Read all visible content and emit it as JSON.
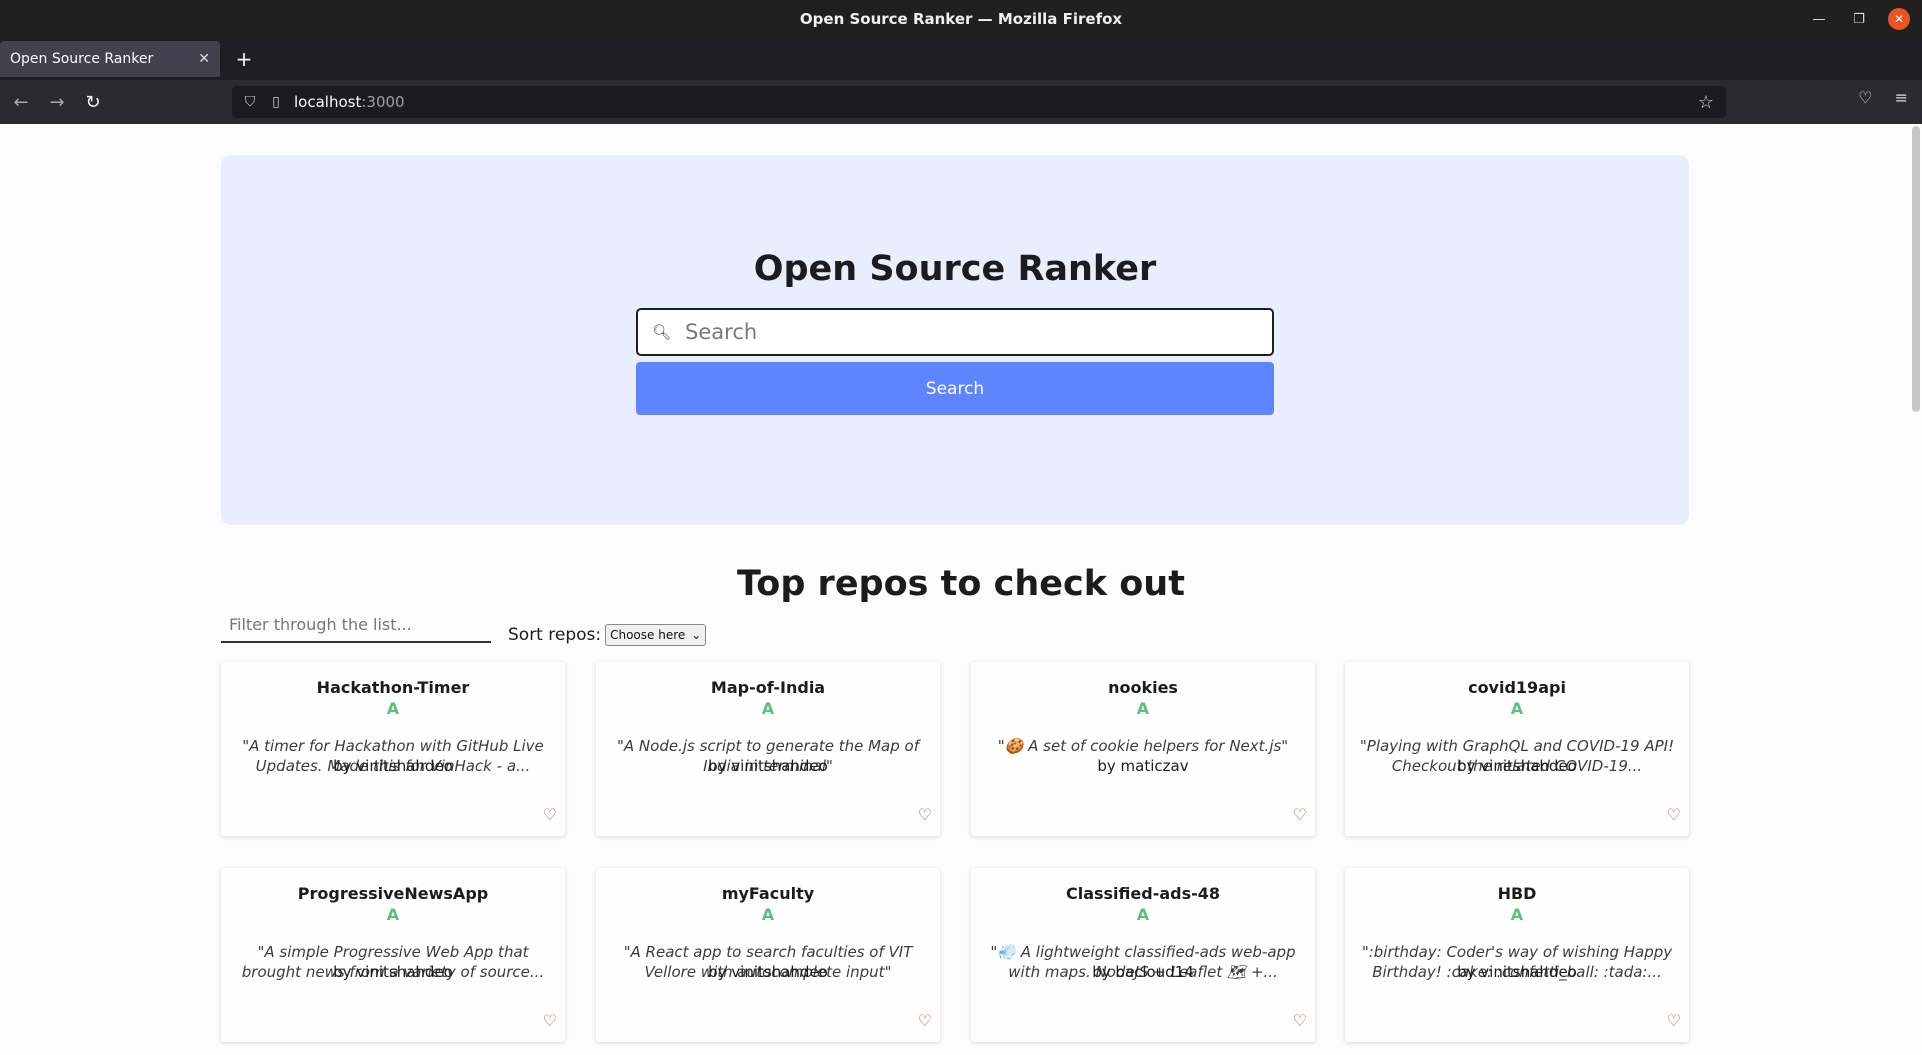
{
  "window": {
    "title": "Open Source Ranker — Mozilla Firefox"
  },
  "browser": {
    "tab_title": "Open Source Ranker",
    "url_host": "localhost",
    "url_port": ":3000"
  },
  "hero": {
    "title": "Open Source Ranker",
    "search_placeholder": "Search",
    "search_button": "Search"
  },
  "list": {
    "title": "Top repos to check out",
    "filter_placeholder": "Filter through the list...",
    "sort_label": "Sort repos:",
    "sort_selected": "Choose here"
  },
  "repos": [
    {
      "name": "Hackathon-Timer",
      "grade": "A",
      "description": "\"A timer for Hackathon with GitHub Live Updates. Made this for VinHack - a...",
      "author": "by vinitshahdeo"
    },
    {
      "name": "Map-of-India",
      "grade": "A",
      "description": "\"A Node.js script to generate the Map of India in terminal\"",
      "author": "by vinitshahdeo"
    },
    {
      "name": "nookies",
      "grade": "A",
      "description": "\"🍪 A set of cookie helpers for Next.js\"",
      "author": "by maticzav"
    },
    {
      "name": "covid19api",
      "grade": "A",
      "description": "\"Playing with GraphQL and COVID-19 API! Checkout the related COVID-19...",
      "author": "by vinitshahdeo"
    },
    {
      "name": "ProgressiveNewsApp",
      "grade": "A",
      "description": "\"A simple Progressive Web App that brought news from a variety of source...",
      "author": "by vinitshahdeo"
    },
    {
      "name": "myFaculty",
      "grade": "A",
      "description": "\"A React app to search faculties of VIT Vellore with autocomplete input\"",
      "author": "by vinitshahdeo"
    },
    {
      "name": "Classified-ads-48",
      "grade": "A",
      "description": "\"💨 A lightweight classified-ads web-app with maps. NodeJS + Leaflet 🗺 +...",
      "author": "by bacloud14"
    },
    {
      "name": "HBD",
      "grade": "A",
      "description": "\":birthday: Coder's way of wishing Happy Birthday! :cake: :confetti_ball: :tada:...",
      "author": "by vinitshahdeo"
    }
  ],
  "colors": {
    "accent": "#5e85ff",
    "hero_bg": "#e8eefd",
    "grade": "#5cbf7c",
    "heart": "#e04848"
  }
}
